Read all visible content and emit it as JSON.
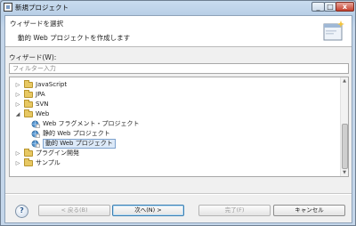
{
  "window": {
    "title": "新規プロジェクト",
    "close_glyph": "x",
    "maximize_glyph": "□",
    "minimize_glyph": "_"
  },
  "banner": {
    "title": "ウィザードを選択",
    "description": "動的 Web プロジェクトを作成します"
  },
  "filter": {
    "label": "ウィザード(W):",
    "placeholder": "フィルター入力",
    "value": ""
  },
  "tree": {
    "items": [
      {
        "label": "JavaScript",
        "expanded": false,
        "level": 0,
        "icon": "folder-icon"
      },
      {
        "label": "JPA",
        "expanded": false,
        "level": 0,
        "icon": "folder-icon"
      },
      {
        "label": "SVN",
        "expanded": false,
        "level": 0,
        "icon": "folder-icon"
      },
      {
        "label": "Web",
        "expanded": true,
        "level": 0,
        "icon": "folder-icon"
      },
      {
        "label": "Web フラグメント・プロジェクト",
        "level": 1,
        "icon": "web-fragment-icon"
      },
      {
        "label": "静的 Web プロジェクト",
        "level": 1,
        "icon": "static-web-icon"
      },
      {
        "label": "動的 Web プロジェクト",
        "level": 1,
        "icon": "dynamic-web-icon",
        "selected": true
      },
      {
        "label": "プラグイン開発",
        "expanded": false,
        "level": 0,
        "icon": "folder-icon"
      },
      {
        "label": "サンプル",
        "expanded": false,
        "level": 0,
        "icon": "folder-icon"
      }
    ]
  },
  "buttons": {
    "help": "?",
    "back": "< 戻る(B)",
    "next": "次へ(N) >",
    "finish": "完了(F)",
    "cancel": "キャンセル"
  },
  "colors": {
    "selection": "#dce9f8",
    "selection_border": "#7da2ce",
    "titlebar": "#c9dcef"
  }
}
